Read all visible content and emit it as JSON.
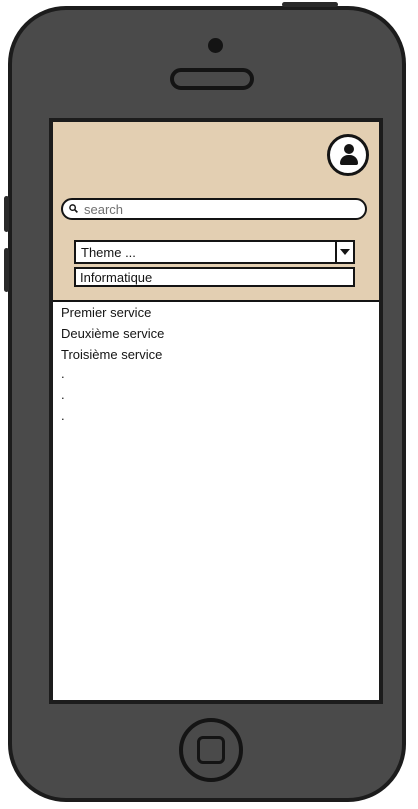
{
  "search": {
    "placeholder": "search"
  },
  "theme_select": {
    "value": "Theme ...",
    "options": [
      "Informatique"
    ]
  },
  "services": [
    "Premier service",
    "Deuxième service",
    "Troisième service",
    ".",
    ".",
    "."
  ],
  "colors": {
    "header_bg": "#e3cfb2",
    "phone_body": "#4a4a4a",
    "outline": "#141414"
  },
  "icons": {
    "avatar": "user-avatar-icon",
    "search": "search-icon",
    "dropdown": "chevron-down-icon"
  }
}
